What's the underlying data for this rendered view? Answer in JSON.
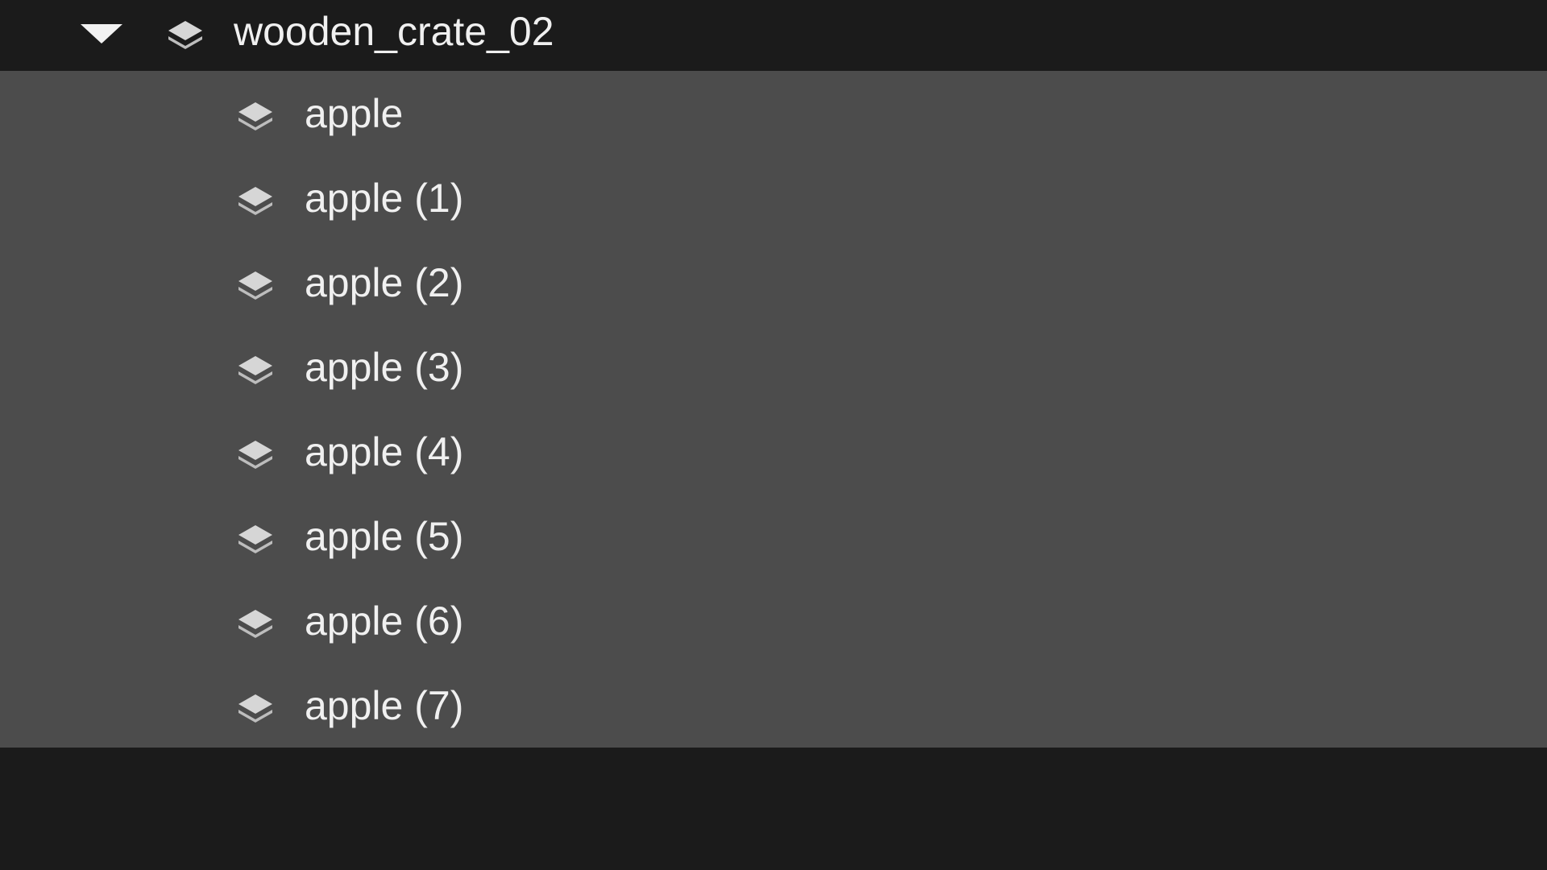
{
  "outliner": {
    "parent": {
      "label": "wooden_crate_02",
      "icon": "layers-icon",
      "expanded": true
    },
    "children": [
      {
        "label": "apple",
        "icon": "layers-icon"
      },
      {
        "label": "apple (1)",
        "icon": "layers-icon"
      },
      {
        "label": "apple (2)",
        "icon": "layers-icon"
      },
      {
        "label": "apple (3)",
        "icon": "layers-icon"
      },
      {
        "label": "apple (4)",
        "icon": "layers-icon"
      },
      {
        "label": "apple (5)",
        "icon": "layers-icon"
      },
      {
        "label": "apple (6)",
        "icon": "layers-icon"
      },
      {
        "label": "apple (7)",
        "icon": "layers-icon"
      }
    ]
  },
  "colors": {
    "background": "#1b1b1b",
    "selection": "#4c4c4c",
    "text": "#f0f0f0",
    "icon": "#d8d8d8"
  }
}
